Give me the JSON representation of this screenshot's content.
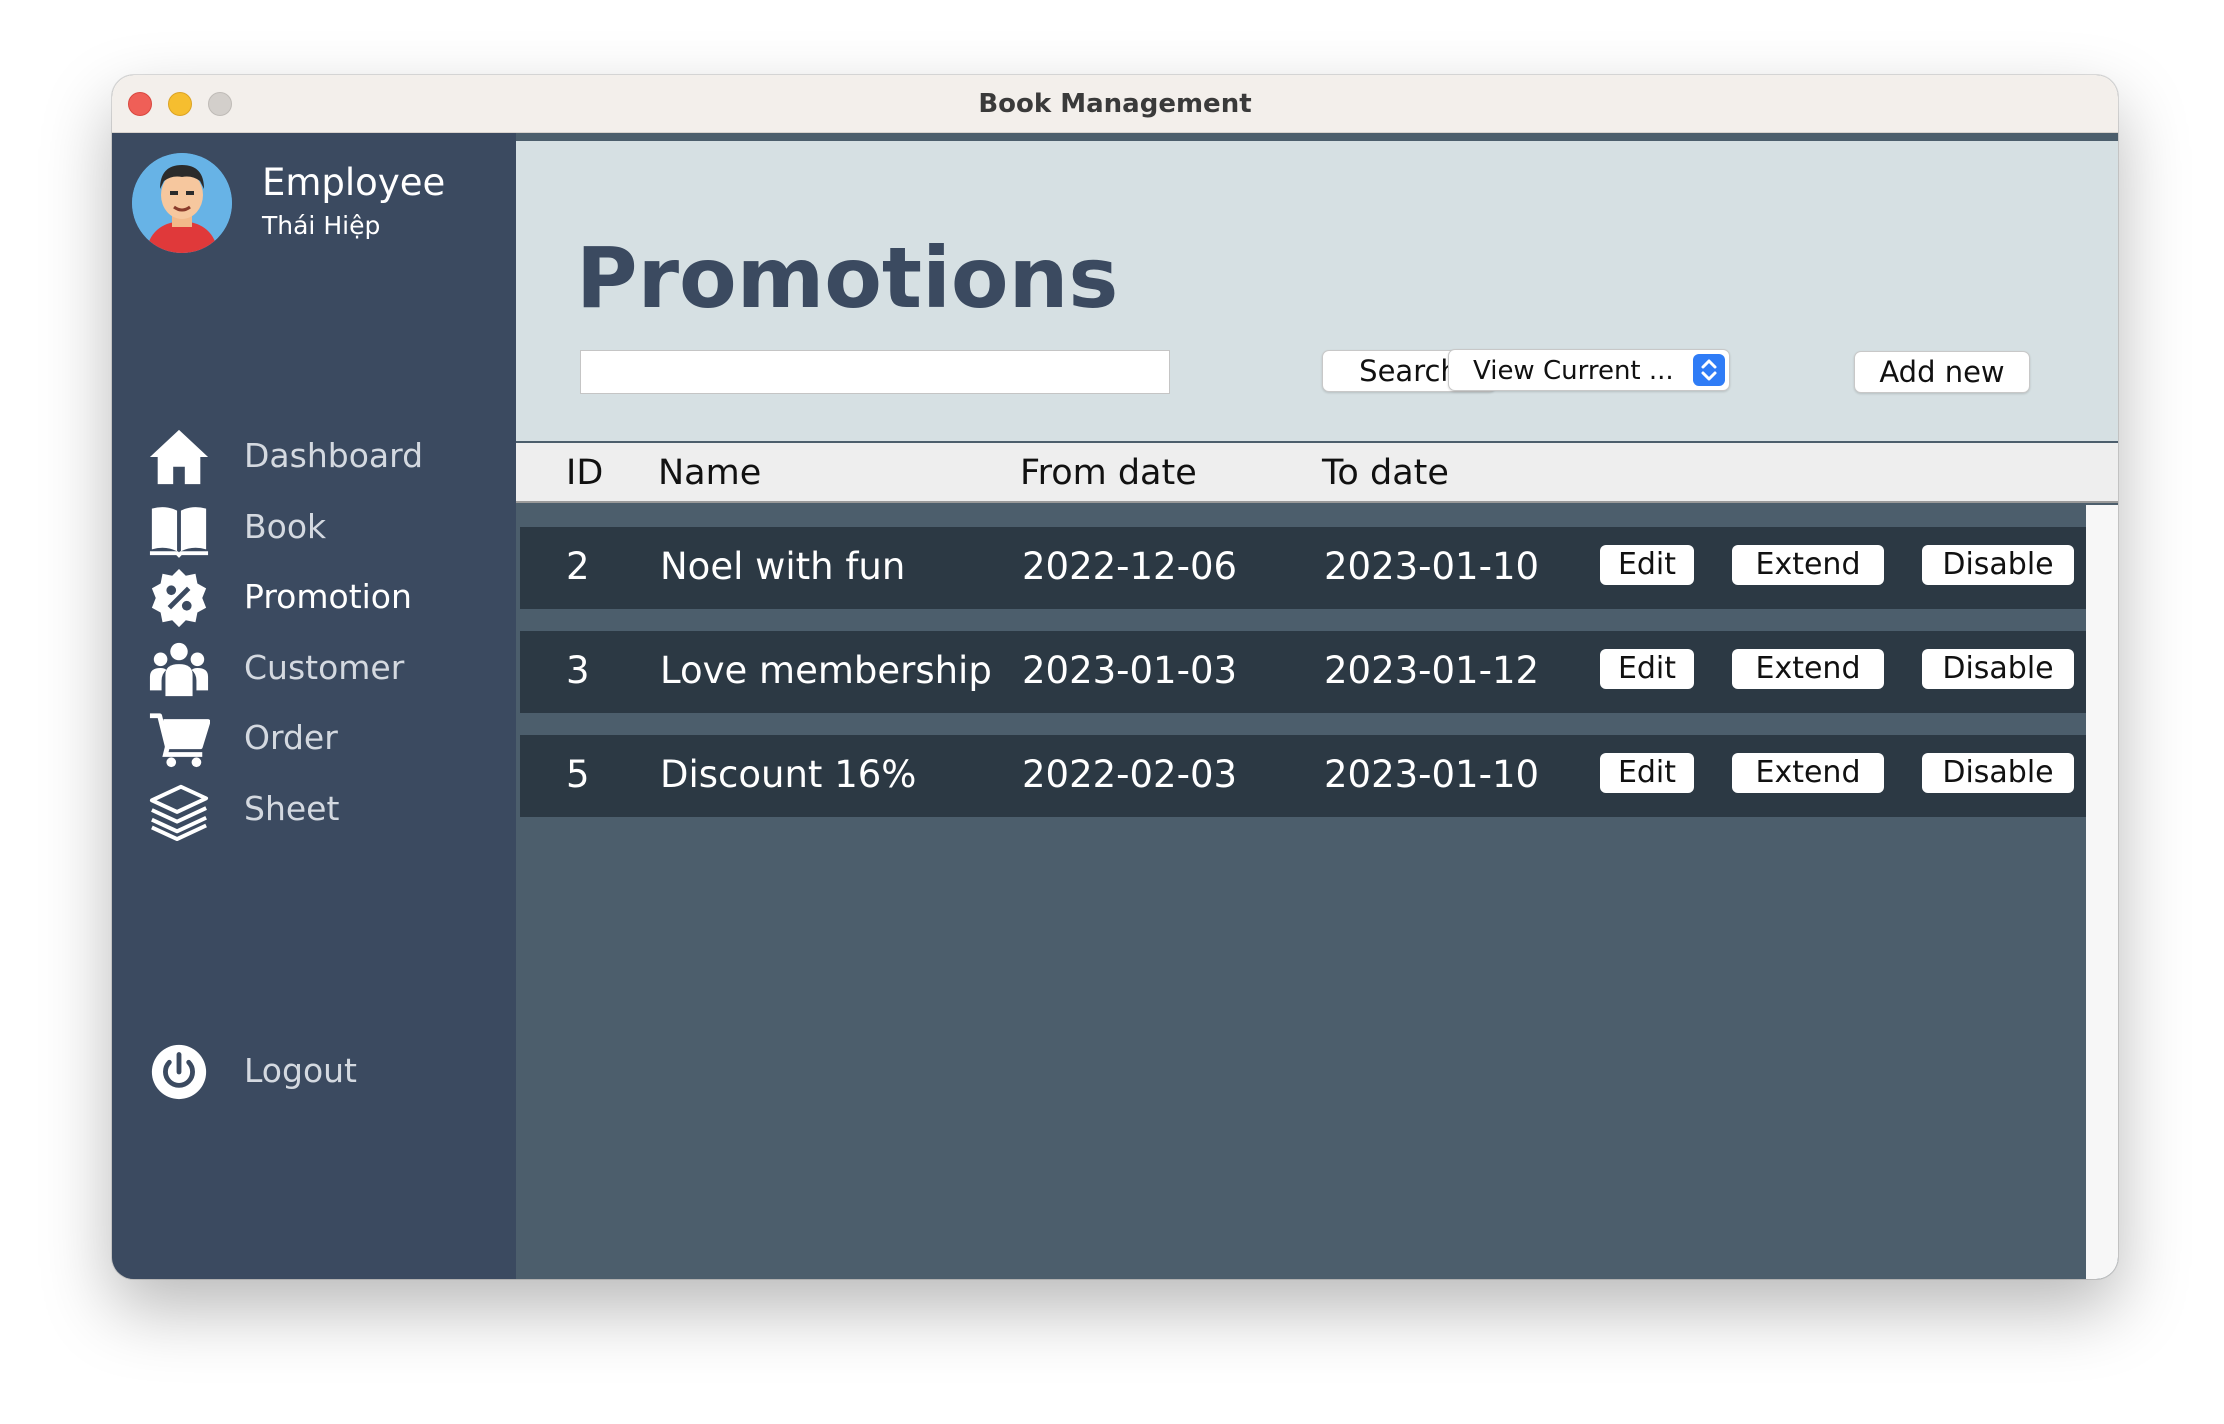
{
  "window": {
    "title": "Book Management"
  },
  "user": {
    "role": "Employee",
    "name": "Thái Hiệp"
  },
  "sidebar": {
    "items": [
      {
        "label": "Dashboard",
        "icon": "home-icon"
      },
      {
        "label": "Book",
        "icon": "book-icon"
      },
      {
        "label": "Promotion",
        "icon": "promotion-badge-icon",
        "active": true
      },
      {
        "label": "Customer",
        "icon": "users-icon"
      },
      {
        "label": "Order",
        "icon": "cart-icon"
      },
      {
        "label": "Sheet",
        "icon": "layers-icon"
      }
    ],
    "logout": {
      "label": "Logout",
      "icon": "power-icon"
    }
  },
  "page": {
    "title": "Promotions"
  },
  "toolbar": {
    "search_value": "",
    "search_label": "Search",
    "filter_selected": "View Current ...",
    "add_label": "Add new"
  },
  "table": {
    "columns": [
      "ID",
      "Name",
      "From date",
      "To date"
    ],
    "rows": [
      {
        "id": "2",
        "name": "Noel with fun",
        "from": "2022-12-06",
        "to": "2023-01-10",
        "edit": "Edit",
        "extend": "Extend",
        "disable": "Disable"
      },
      {
        "id": "3",
        "name": "Love membership",
        "from": "2023-01-03",
        "to": "2023-01-12",
        "edit": "Edit",
        "extend": "Extend",
        "disable": "Disable"
      },
      {
        "id": "5",
        "name": "Discount 16%",
        "from": "2022-02-03",
        "to": "2023-01-10",
        "edit": "Edit",
        "extend": "Extend",
        "disable": "Disable"
      }
    ]
  },
  "colors": {
    "sidebar_bg": "#3b4a60",
    "header_bg": "#d6e0e3",
    "row_bg": "#2c3944",
    "table_bg": "#4c5e6c",
    "accent": "#2f7cf6"
  }
}
